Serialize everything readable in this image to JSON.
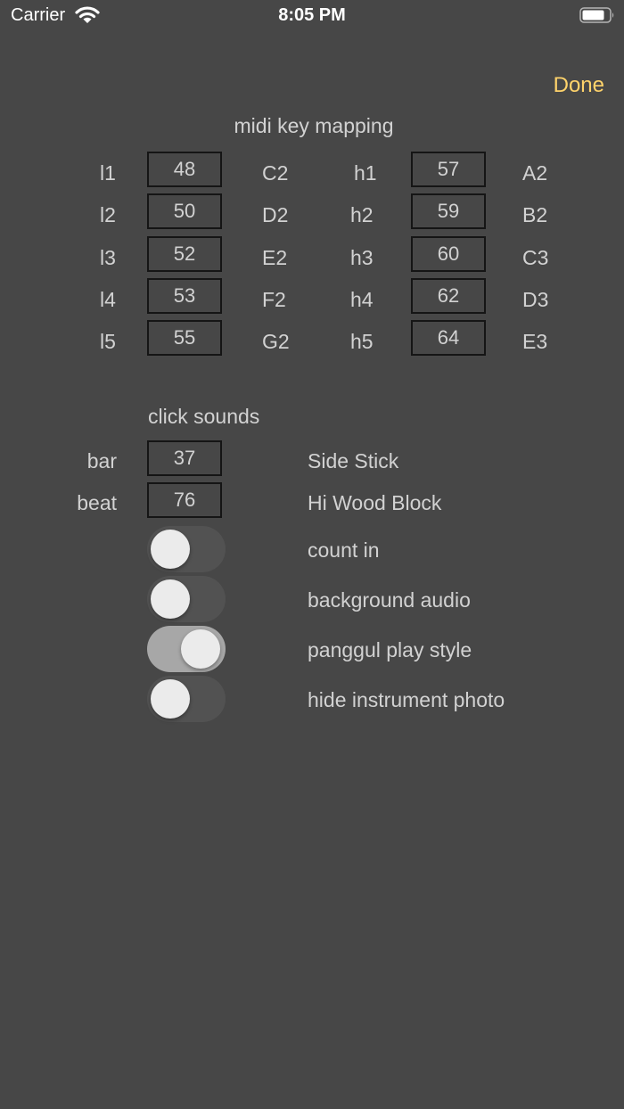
{
  "status_bar": {
    "carrier": "Carrier",
    "time": "8:05 PM",
    "wifi_icon": "wifi-icon",
    "battery_icon": "battery-icon"
  },
  "nav": {
    "done_label": "Done",
    "accent_color": "#ffd36b"
  },
  "midi": {
    "title": "midi key mapping",
    "low": [
      {
        "label": "l1",
        "value": "48",
        "note": "C2"
      },
      {
        "label": "l2",
        "value": "50",
        "note": "D2"
      },
      {
        "label": "l3",
        "value": "52",
        "note": "E2"
      },
      {
        "label": "l4",
        "value": "53",
        "note": "F2"
      },
      {
        "label": "l5",
        "value": "55",
        "note": "G2"
      }
    ],
    "high": [
      {
        "label": "h1",
        "value": "57",
        "note": "A2"
      },
      {
        "label": "h2",
        "value": "59",
        "note": "B2"
      },
      {
        "label": "h3",
        "value": "60",
        "note": "C3"
      },
      {
        "label": "h4",
        "value": "62",
        "note": "D3"
      },
      {
        "label": "h5",
        "value": "64",
        "note": "E3"
      }
    ]
  },
  "click": {
    "title": "click sounds",
    "bar": {
      "label": "bar",
      "value": "37",
      "sound": "Side Stick"
    },
    "beat": {
      "label": "beat",
      "value": "76",
      "sound": "Hi Wood Block"
    }
  },
  "toggles": [
    {
      "label": "count in",
      "on": false
    },
    {
      "label": "background audio",
      "on": false
    },
    {
      "label": "panggul play style",
      "on": true
    },
    {
      "label": "hide instrument photo",
      "on": false
    }
  ]
}
